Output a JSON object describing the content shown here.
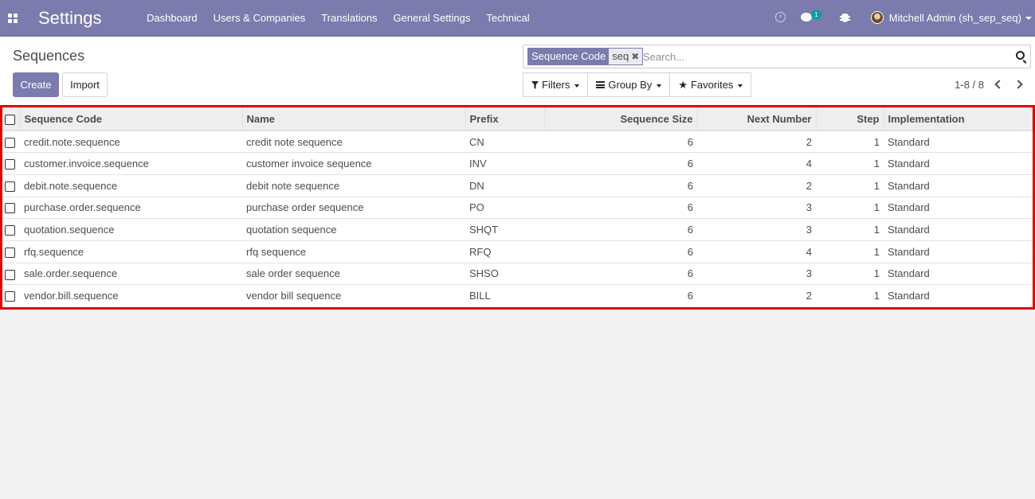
{
  "navbar": {
    "brand": "Settings",
    "menu": [
      "Dashboard",
      "Users & Companies",
      "Translations",
      "General Settings",
      "Technical"
    ],
    "chat_badge": "1",
    "user": "Mitchell Admin (sh_sep_seq)"
  },
  "control_panel": {
    "title": "Sequences",
    "create_label": "Create",
    "import_label": "Import",
    "facet_label": "Sequence Code",
    "facet_value": "seq",
    "search_placeholder": "Search...",
    "filters_label": "Filters",
    "groupby_label": "Group By",
    "favorites_label": "Favorites",
    "pager": "1-8 / 8"
  },
  "table": {
    "headers": [
      "Sequence Code",
      "Name",
      "Prefix",
      "Sequence Size",
      "Next Number",
      "Step",
      "Implementation"
    ],
    "rows": [
      [
        "credit.note.sequence",
        "credit note sequence",
        "CN",
        "6",
        "2",
        "1",
        "Standard"
      ],
      [
        "customer.invoice.sequence",
        "customer invoice sequence",
        "INV",
        "6",
        "4",
        "1",
        "Standard"
      ],
      [
        "debit.note.sequence",
        "debit note sequence",
        "DN",
        "6",
        "2",
        "1",
        "Standard"
      ],
      [
        "purchase.order.sequence",
        "purchase order sequence",
        "PO",
        "6",
        "3",
        "1",
        "Standard"
      ],
      [
        "quotation.sequence",
        "quotation sequence",
        "SHQT",
        "6",
        "3",
        "1",
        "Standard"
      ],
      [
        "rfq.sequence",
        "rfq sequence",
        "RFQ",
        "6",
        "4",
        "1",
        "Standard"
      ],
      [
        "sale.order.sequence",
        "sale order sequence",
        "SHSO",
        "6",
        "3",
        "1",
        "Standard"
      ],
      [
        "vendor.bill.sequence",
        "vendor bill sequence",
        "BILL",
        "6",
        "2",
        "1",
        "Standard"
      ]
    ]
  },
  "colors": {
    "brand": "#7c7bad",
    "highlight_border": "#e30000"
  }
}
